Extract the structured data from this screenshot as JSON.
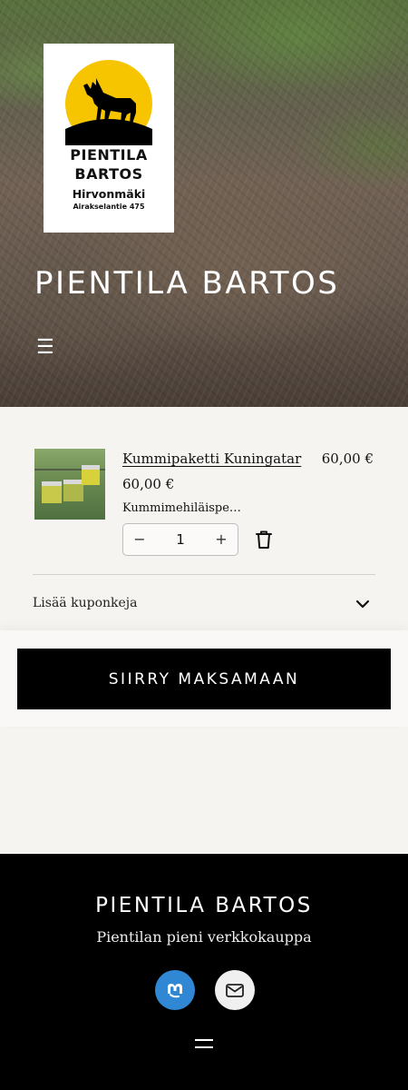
{
  "hero": {
    "logo": {
      "line1": "PIENTILA",
      "line2": "BARTOS",
      "line3": "Hirvonmäki",
      "line4": "Airakselantie 475"
    },
    "title": "PIENTILA BARTOS",
    "menu_icon": "menu-icon"
  },
  "cart": {
    "item": {
      "name": "Kummipaketti Kuningatar",
      "total": "60,00 €",
      "price": "60,00 €",
      "description": "Kummimehiläispe…",
      "quantity": "1",
      "minus": "−",
      "plus": "+"
    },
    "coupon_label": "Lisää kuponkeja",
    "checkout_label": "SIIRRY MAKSAMAAN"
  },
  "footer": {
    "title": "PIENTILA BARTOS",
    "tagline": "Pientilan pieni verkkokauppa",
    "social": [
      "mastodon-icon",
      "mail-icon"
    ]
  },
  "colors": {
    "logo_sun": "#f7c400",
    "checkout_bg": "#000000",
    "footer_bg": "#000000",
    "mastodon": "#3088d4"
  }
}
